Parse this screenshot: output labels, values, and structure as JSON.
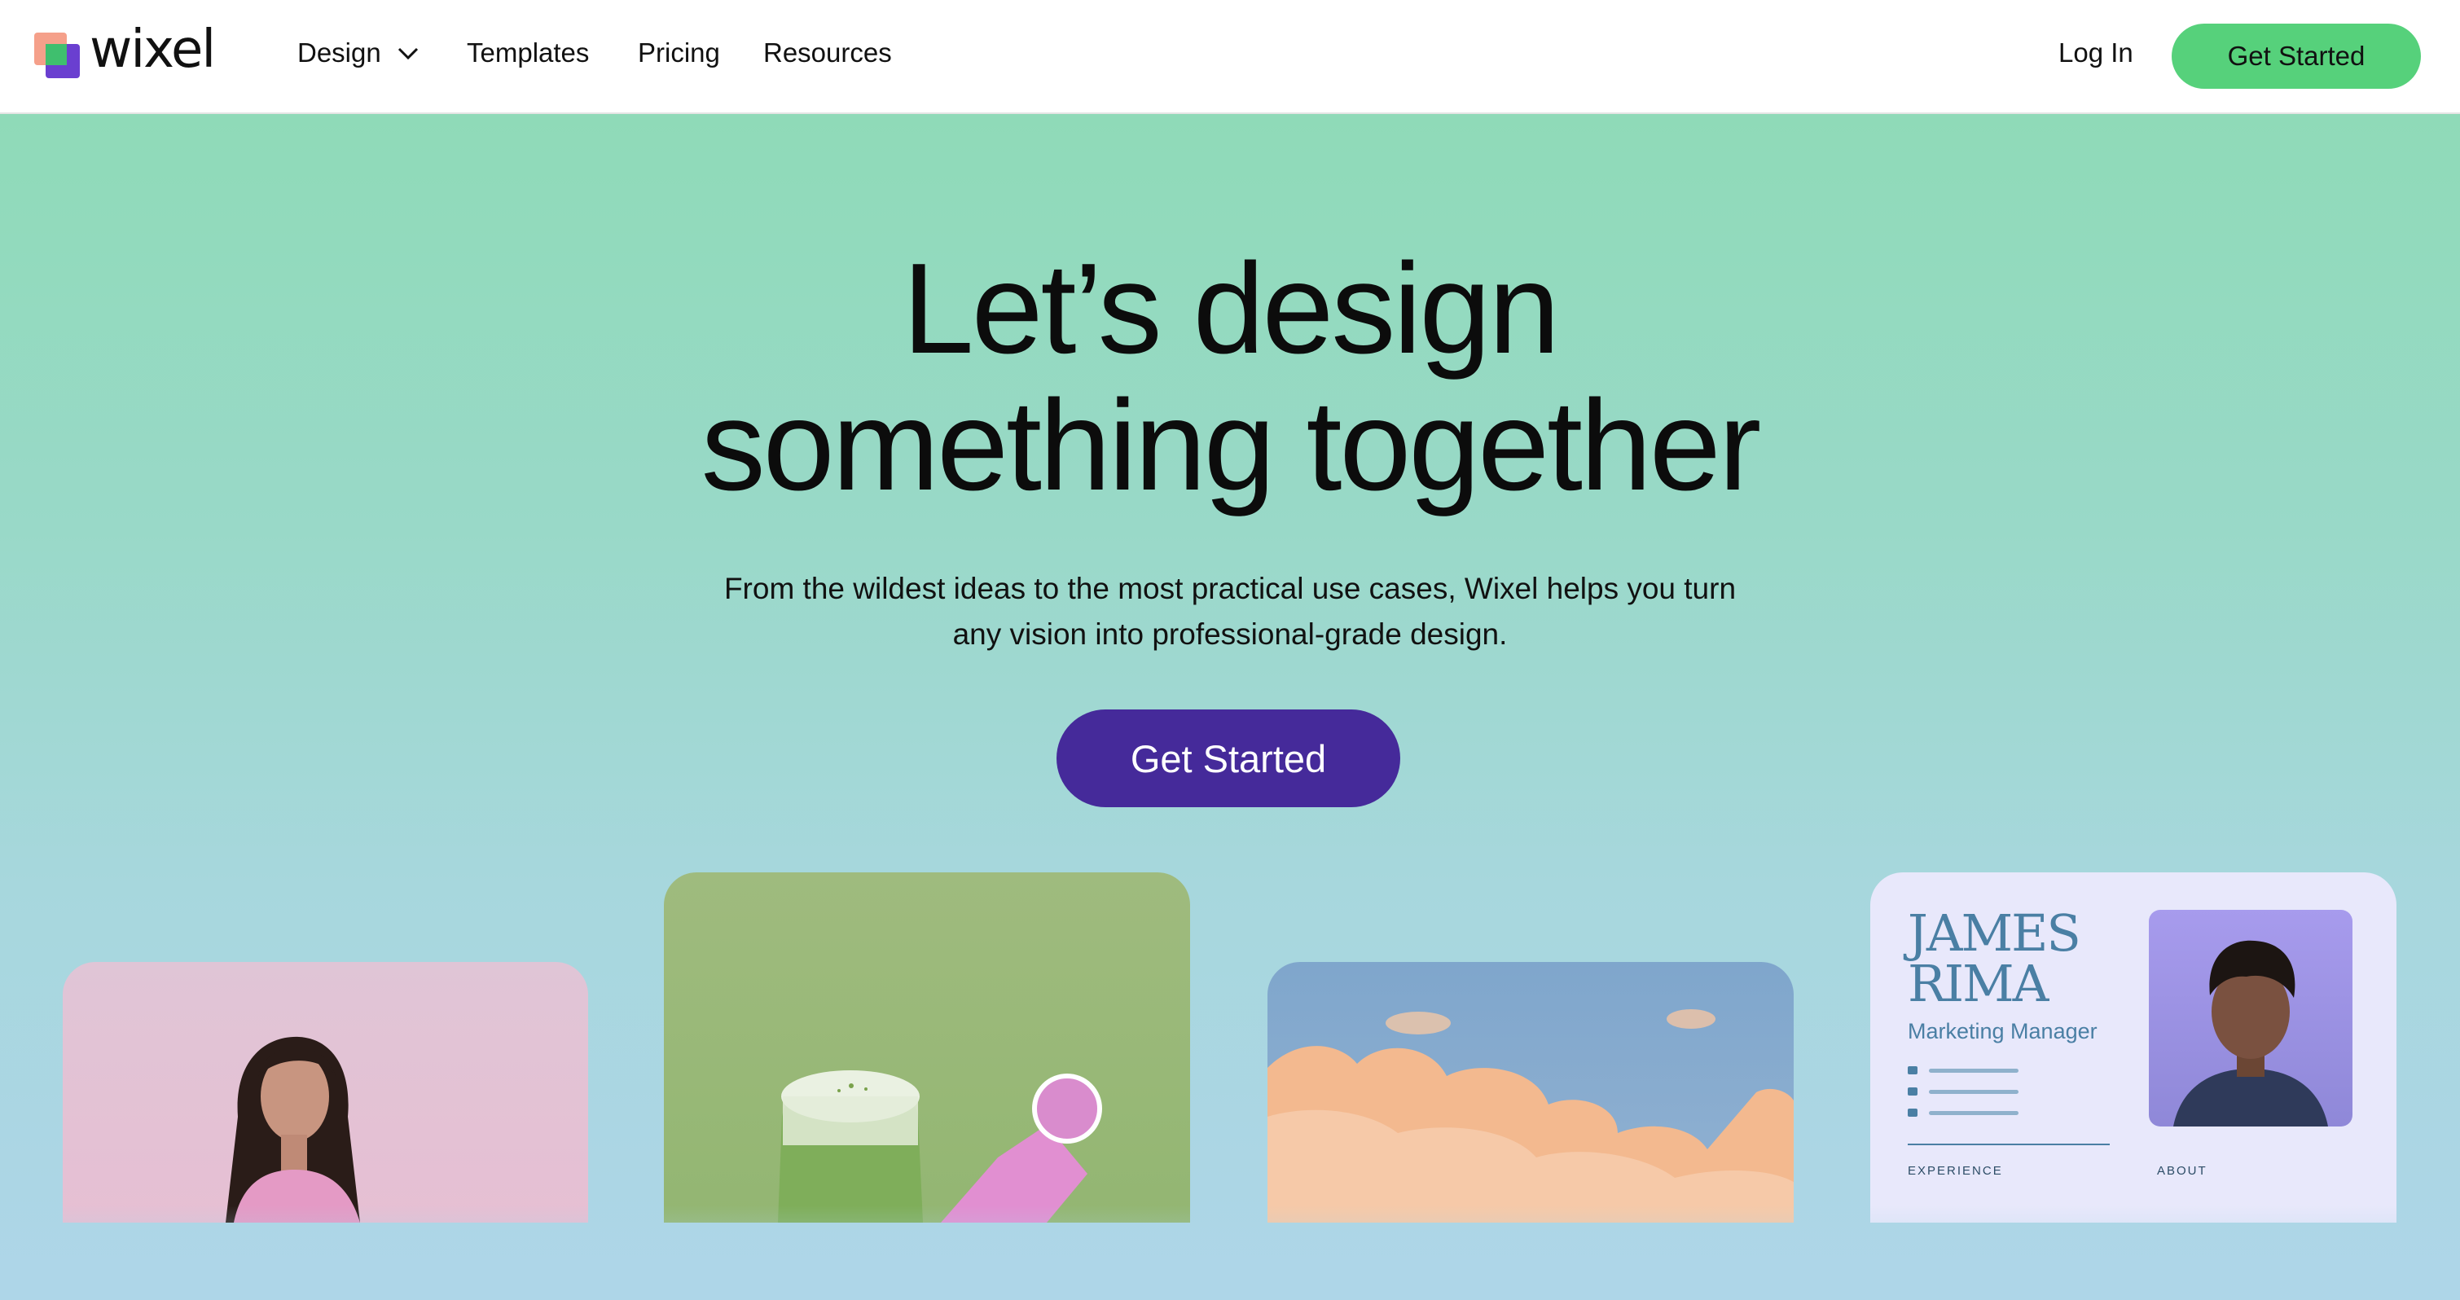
{
  "brand": {
    "name": "wixel"
  },
  "nav": {
    "items": [
      {
        "label": "Design"
      },
      {
        "label": "Templates"
      },
      {
        "label": "Pricing"
      },
      {
        "label": "Resources"
      }
    ],
    "login_label": "Log In",
    "cta_label": "Get Started"
  },
  "hero": {
    "title_line1": "Let’s design",
    "title_line2": "something together",
    "subtitle_line1": "From the wildest ideas to the most practical use cases, Wixel helps you turn",
    "subtitle_line2": "any vision into professional-grade design.",
    "cta_label": "Get Started"
  },
  "business_card": {
    "first_name": "JAMES",
    "last_name": "RIMA",
    "role": "Marketing Manager",
    "section_experience": "EXPERIENCE",
    "section_about": "ABOUT"
  },
  "colors": {
    "nav_cta": "#56d17b",
    "hero_cta": "#452a9a",
    "hero_top": "#8fdab8",
    "hero_bottom": "#aed6e8"
  }
}
